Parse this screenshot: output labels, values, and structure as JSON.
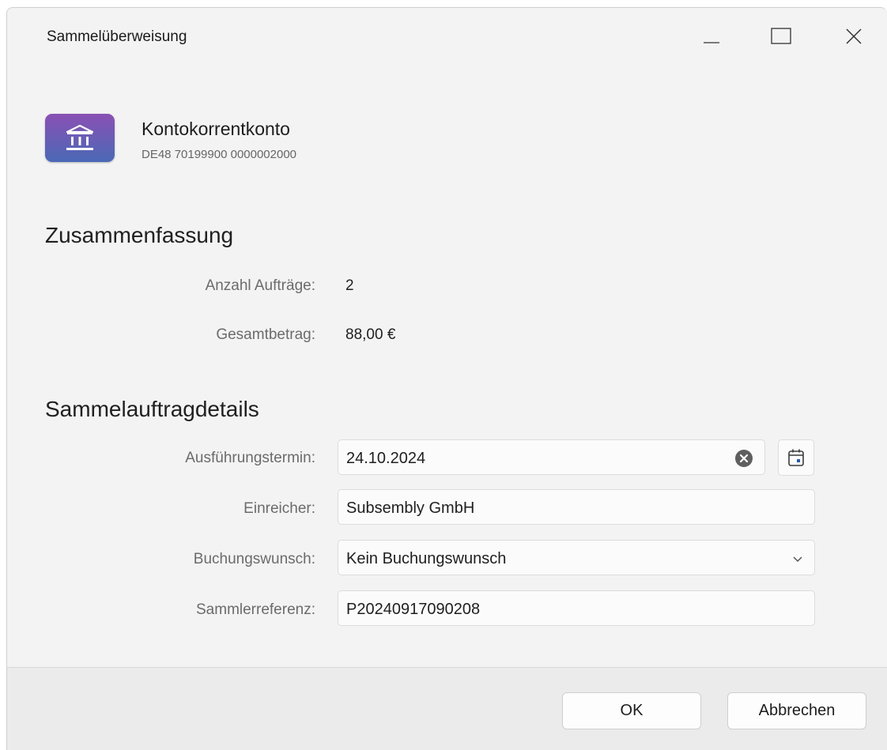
{
  "window": {
    "title": "Sammelüberweisung",
    "controls": [
      "minimize-icon",
      "maximize-icon",
      "close-icon"
    ]
  },
  "account": {
    "icon": "bank-icon",
    "name": "Kontokorrentkonto",
    "iban": "DE48 70199900 0000002000",
    "icon_gradient": [
      "#8a50b4",
      "#4a69b6"
    ]
  },
  "summary": {
    "heading": "Zusammenfassung",
    "count_label": "Anzahl Aufträge:",
    "count_value": "2",
    "total_label": "Gesamtbetrag:",
    "total_value": "88,00 €"
  },
  "details": {
    "heading": "Sammelauftragdetails",
    "execution_date": {
      "label": "Ausführungstermin:",
      "value": "24.10.2024"
    },
    "submitter": {
      "label": "Einreicher:",
      "value": "Subsembly GmbH"
    },
    "booking_request": {
      "label": "Buchungswunsch:",
      "value": "Kein Buchungswunsch"
    },
    "collector_reference": {
      "label": "Sammlerreferenz:",
      "value": "P20240917090208"
    }
  },
  "footer": {
    "ok_label": "OK",
    "cancel_label": "Abbrechen"
  }
}
